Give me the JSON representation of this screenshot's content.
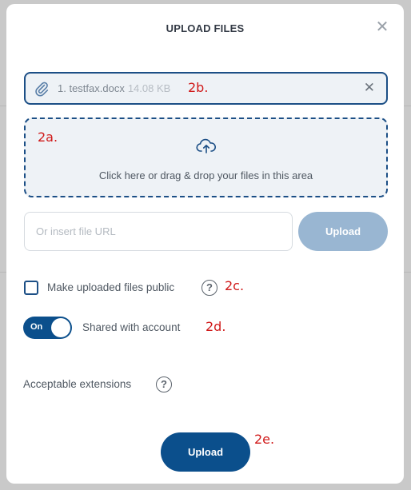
{
  "modal": {
    "title": "UPLOAD FILES",
    "close_glyph": "✕"
  },
  "file": {
    "name": "1. testfax.docx",
    "size": "14.08 KB",
    "remove_glyph": "✕"
  },
  "dropzone": {
    "text": "Click here or drag & drop your files in this area"
  },
  "url": {
    "placeholder": "Or insert file URL",
    "button_label": "Upload"
  },
  "public": {
    "label": "Make uploaded files public",
    "checked": false
  },
  "shared": {
    "toggle_text": "On",
    "label": "Shared with account"
  },
  "extensions": {
    "label": "Acceptable extensions"
  },
  "help_glyph": "?",
  "upload_button": "Upload",
  "annotations": {
    "a": "2a.",
    "b": "2b.",
    "c": "2c.",
    "d": "2d.",
    "e": "2e."
  },
  "icons": {
    "close": "close-icon",
    "attachment": "paperclip-icon",
    "upload": "cloud-upload-icon",
    "help": "question-circle-icon"
  },
  "colors": {
    "primary": "#0b4f8c",
    "primary_disabled": "#99b6d2",
    "annotation": "#d01919"
  }
}
